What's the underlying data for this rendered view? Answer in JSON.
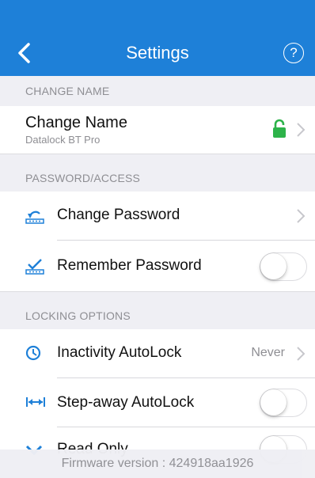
{
  "nav": {
    "title": "Settings",
    "help_label": "?",
    "color": "#1e80d8"
  },
  "sections": {
    "change_name": "CHANGE NAME",
    "password_access": "PASSWORD/ACCESS",
    "locking_options": "LOCKING OPTIONS"
  },
  "change_name": {
    "label": "Change Name",
    "device": "Datalock BT Pro",
    "lock_color": "#2db34a",
    "lock_icon": "lock-open-icon"
  },
  "password": {
    "change_label": "Change Password",
    "remember_label": "Remember Password",
    "remember_on": false
  },
  "locking": {
    "inactivity_label": "Inactivity AutoLock",
    "inactivity_value": "Never",
    "stepaway_label": "Step-away AutoLock",
    "stepaway_on": false,
    "readonly_label": "Read Only",
    "readonly_on": false
  },
  "footer": {
    "firmware": "Firmware version : 424918aa1926"
  }
}
